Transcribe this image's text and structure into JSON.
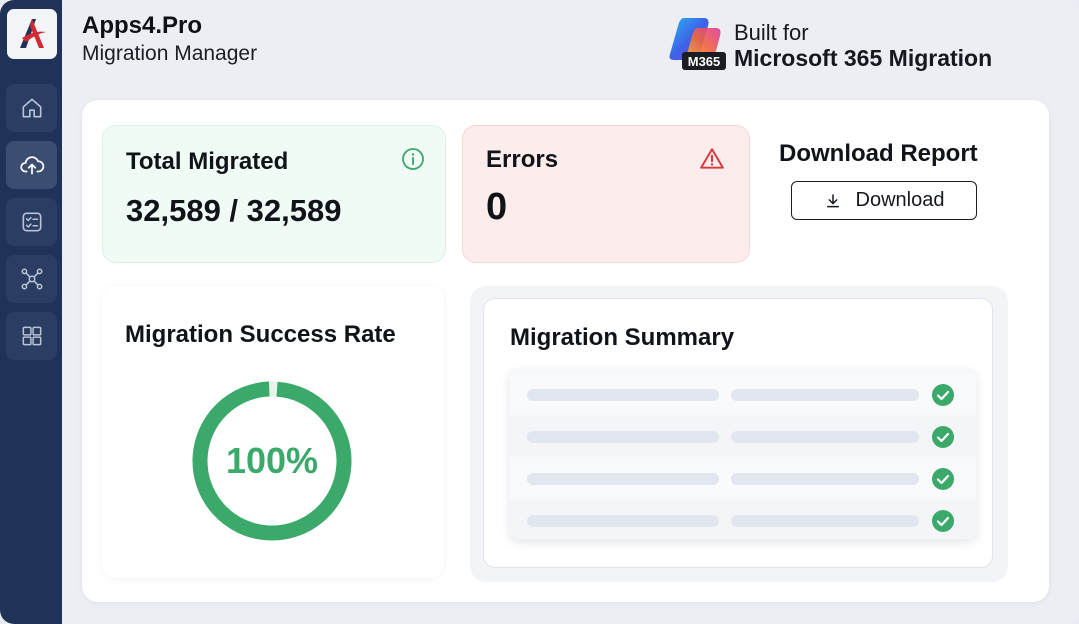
{
  "brand": {
    "title": "Apps4.Pro",
    "subtitle": "Migration Manager"
  },
  "built_for": {
    "line1": "Built for",
    "line2": "Microsoft 365 Migration",
    "badge_text": "M365"
  },
  "sidebar": {
    "items": [
      {
        "name": "home",
        "icon": "home-icon"
      },
      {
        "name": "cloud-upload",
        "icon": "cloud-upload-icon",
        "active": true
      },
      {
        "name": "checklist",
        "icon": "checklist-icon"
      },
      {
        "name": "network",
        "icon": "network-icon"
      },
      {
        "name": "apps-grid",
        "icon": "grid-icon"
      }
    ]
  },
  "stats": {
    "total_label": "Total Migrated",
    "total_value": "32,589 / 32,589",
    "errors_label": "Errors",
    "errors_value": "0"
  },
  "download": {
    "title": "Download Report",
    "button_label": "Download"
  },
  "success_rate": {
    "title": "Migration Success Rate",
    "value_text": "100%",
    "fraction": 1.0
  },
  "summary": {
    "title": "Migration Summary",
    "rows": [
      {
        "status": "success"
      },
      {
        "status": "success"
      },
      {
        "status": "success"
      },
      {
        "status": "success"
      }
    ]
  },
  "colors": {
    "sidebar_bg": "#1f3258",
    "success_green": "#3aa96a",
    "error_red": "#d9373d",
    "total_card_bg": "#f1fbf6",
    "error_card_bg": "#fcecec"
  }
}
